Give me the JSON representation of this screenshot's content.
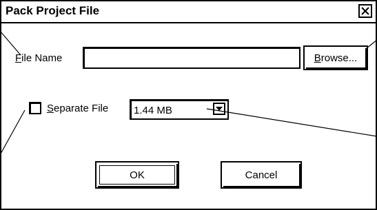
{
  "dialog": {
    "title": "Pack Project File",
    "close_icon": "close-icon"
  },
  "file_name": {
    "label_prefix": "F",
    "label_rest": "ile Name",
    "value": ""
  },
  "browse": {
    "label_prefix": "B",
    "label_rest": "rowse..."
  },
  "separate_file": {
    "label_prefix": "S",
    "label_rest": "eparate File",
    "checked": false
  },
  "disk_size": {
    "selected": "1.44 MB",
    "arrow_icon": "chevron-down-icon"
  },
  "ok": {
    "label": "OK"
  },
  "cancel": {
    "label": "Cancel"
  }
}
